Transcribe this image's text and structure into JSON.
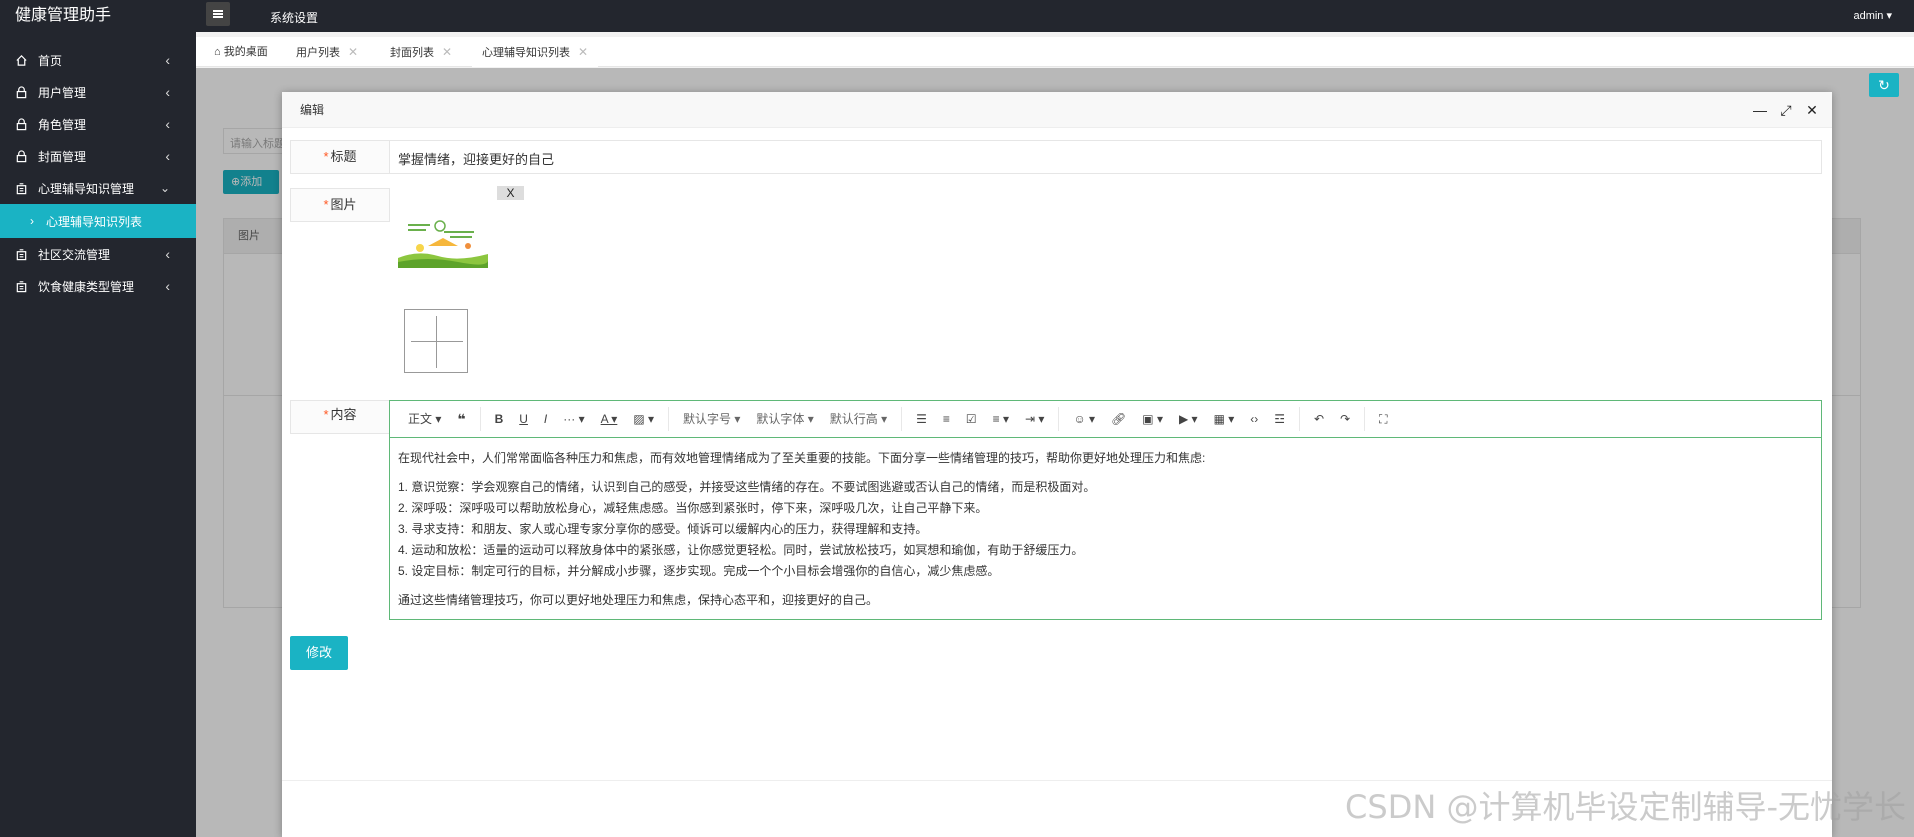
{
  "app": {
    "title": "健康管理助手"
  },
  "topbar": {
    "system_settings": "系统设置",
    "user": "admin ▾"
  },
  "sidebar": {
    "items": [
      {
        "label": "首页"
      },
      {
        "label": "用户管理"
      },
      {
        "label": "角色管理"
      },
      {
        "label": "封面管理"
      },
      {
        "label": "心理辅导知识管理"
      },
      {
        "label": "社区交流管理"
      },
      {
        "label": "饮食健康类型管理"
      }
    ],
    "sub_active": "心理辅导知识列表"
  },
  "tabs": [
    {
      "label": "我的桌面"
    },
    {
      "label": "用户列表"
    },
    {
      "label": "封面列表"
    },
    {
      "label": "心理辅导知识列表"
    }
  ],
  "background": {
    "search_placeholder": "请输入标题",
    "add_label": "添加",
    "table_header": "图片"
  },
  "modal": {
    "title": "编辑",
    "fields": {
      "title_label": "标题",
      "title_value": "掌握情绪，迎接更好的自己",
      "image_label": "图片",
      "image_remove": "X",
      "content_label": "内容",
      "required_mark": "*"
    },
    "toolbar": {
      "paragraph": "正文 ▾",
      "font_size": "默认字号 ▾",
      "font_family": "默认字体 ▾",
      "line_height": "默认行高 ▾"
    },
    "content": {
      "intro": "在现代社会中，人们常常面临各种压力和焦虑，而有效地管理情绪成为了至关重要的技能。下面分享一些情绪管理的技巧，帮助你更好地处理压力和焦虑:",
      "items": [
        "1. 意识觉察：学会观察自己的情绪，认识到自己的感受，并接受这些情绪的存在。不要试图逃避或否认自己的情绪，而是积极面对。",
        "2. 深呼吸：深呼吸可以帮助放松身心，减轻焦虑感。当你感到紧张时，停下来，深呼吸几次，让自己平静下来。",
        "3. 寻求支持：和朋友、家人或心理专家分享你的感受。倾诉可以缓解内心的压力，获得理解和支持。",
        "4. 运动和放松：适量的运动可以释放身体中的紧张感，让你感觉更轻松。同时，尝试放松技巧，如冥想和瑜伽，有助于舒缓压力。",
        "5. 设定目标：制定可行的目标，并分解成小步骤，逐步实现。完成一个个小目标会增强你的自信心，减少焦虑感。"
      ],
      "outro": "通过这些情绪管理技巧，你可以更好地处理压力和焦虑，保持心态平和，迎接更好的自己。"
    },
    "submit_label": "修改"
  },
  "watermark": "CSDN @计算机毕设定制辅导-无忧学长",
  "colors": {
    "accent": "#1ab3c4",
    "sidebar": "#23262e",
    "editor_border": "#5fb878",
    "required": "#ff5722"
  }
}
